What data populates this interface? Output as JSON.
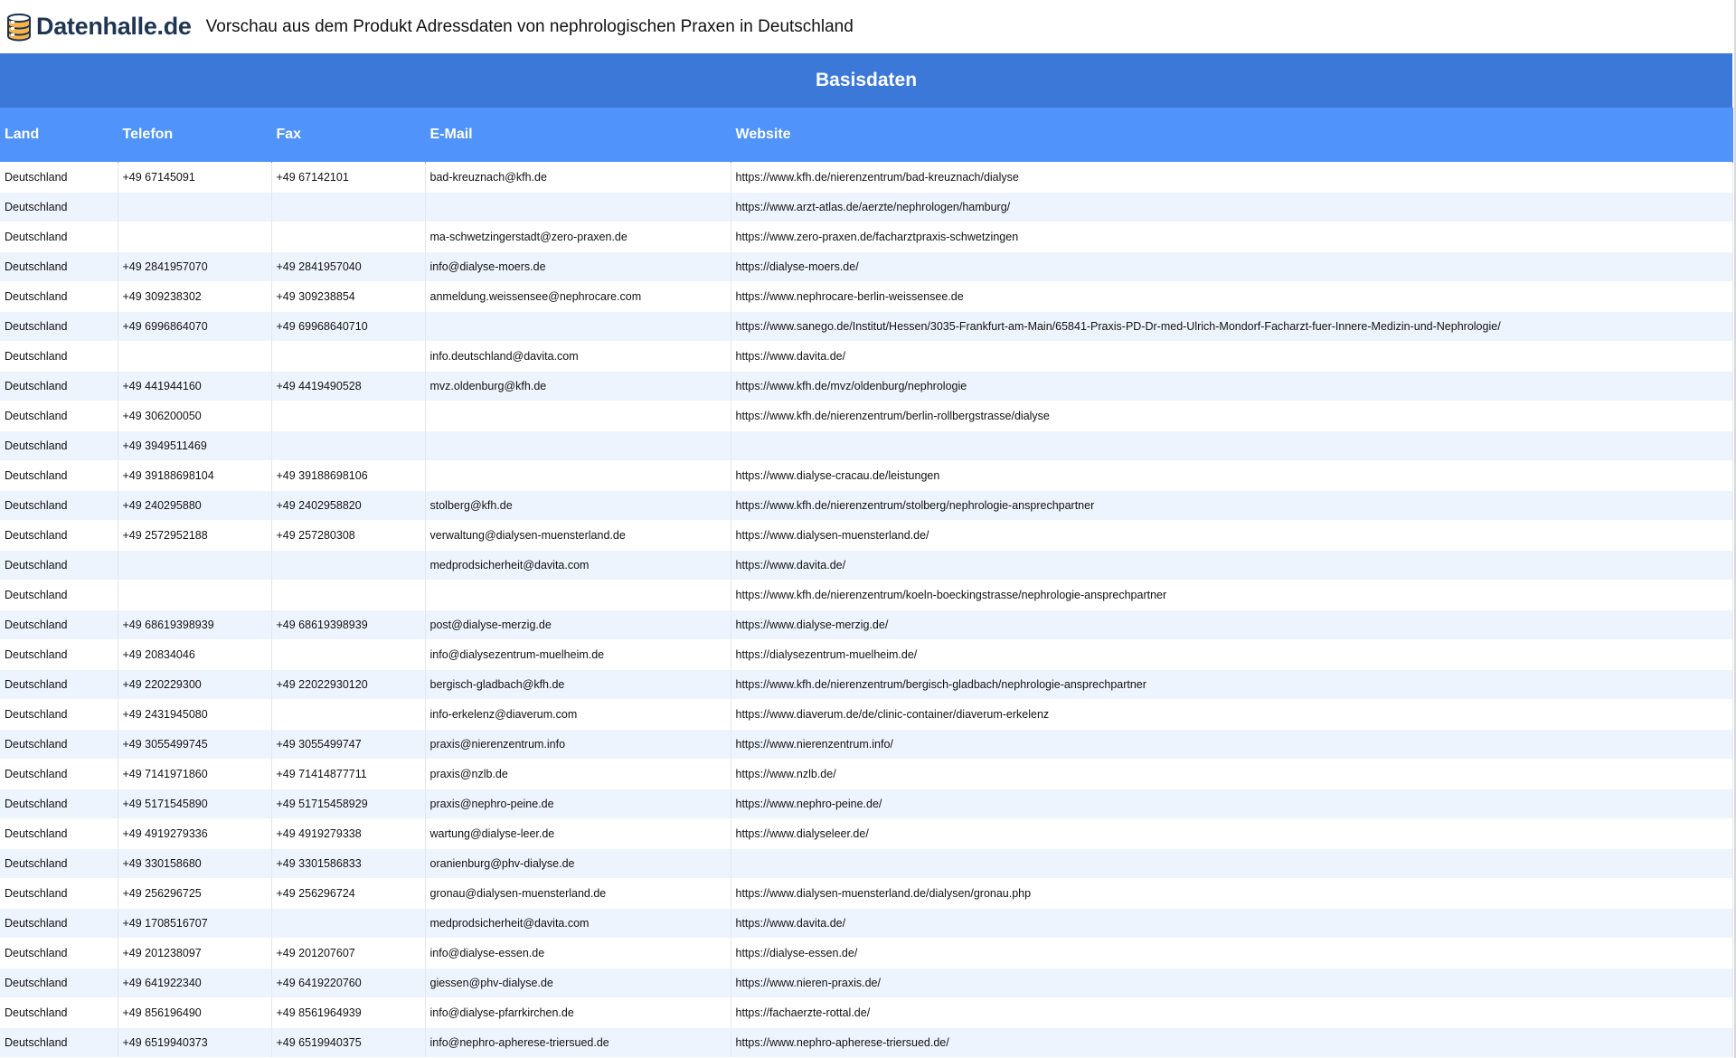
{
  "header": {
    "logo_text": "Datenhalle.de",
    "title": "Vorschau aus dem Produkt Adressdaten von nephrologischen Praxen in Deutschland"
  },
  "table": {
    "group_header": "Basisdaten",
    "columns": [
      "Land",
      "Telefon",
      "Fax",
      "E-Mail",
      "Website"
    ],
    "rows": [
      [
        "Deutschland",
        "+49 67145091",
        "+49 67142101",
        "bad-kreuznach@kfh.de",
        "https://www.kfh.de/nierenzentrum/bad-kreuznach/dialyse"
      ],
      [
        "Deutschland",
        "",
        "",
        "",
        "https://www.arzt-atlas.de/aerzte/nephrologen/hamburg/"
      ],
      [
        "Deutschland",
        "",
        "",
        "ma-schwetzingerstadt@zero-praxen.de",
        "https://www.zero-praxen.de/facharztpraxis-schwetzingen"
      ],
      [
        "Deutschland",
        "+49 2841957070",
        "+49 2841957040",
        "info@dialyse-moers.de",
        "https://dialyse-moers.de/"
      ],
      [
        "Deutschland",
        "+49 309238302",
        "+49 309238854",
        "anmeldung.weissensee@nephrocare.com",
        "https://www.nephrocare-berlin-weissensee.de"
      ],
      [
        "Deutschland",
        "+49 6996864070",
        "+49 69968640710",
        "",
        "https://www.sanego.de/Institut/Hessen/3035-Frankfurt-am-Main/65841-Praxis-PD-Dr-med-Ulrich-Mondorf-Facharzt-fuer-Innere-Medizin-und-Nephrologie/"
      ],
      [
        "Deutschland",
        "",
        "",
        "info.deutschland@davita.com",
        "https://www.davita.de/"
      ],
      [
        "Deutschland",
        "+49 441944160",
        "+49 4419490528",
        "mvz.oldenburg@kfh.de",
        "https://www.kfh.de/mvz/oldenburg/nephrologie"
      ],
      [
        "Deutschland",
        "+49 306200050",
        "",
        "",
        "https://www.kfh.de/nierenzentrum/berlin-rollbergstrasse/dialyse"
      ],
      [
        "Deutschland",
        "+49 3949511469",
        "",
        "",
        ""
      ],
      [
        "Deutschland",
        "+49 39188698104",
        "+49 39188698106",
        "",
        "https://www.dialyse-cracau.de/leistungen"
      ],
      [
        "Deutschland",
        "+49 240295880",
        "+49 2402958820",
        "stolberg@kfh.de",
        "https://www.kfh.de/nierenzentrum/stolberg/nephrologie-ansprechpartner"
      ],
      [
        "Deutschland",
        "+49 2572952188",
        "+49 257280308",
        "verwaltung@dialysen-muensterland.de",
        "https://www.dialysen-muensterland.de/"
      ],
      [
        "Deutschland",
        "",
        "",
        "medprodsicherheit@davita.com",
        "https://www.davita.de/"
      ],
      [
        "Deutschland",
        "",
        "",
        "",
        "https://www.kfh.de/nierenzentrum/koeln-boeckingstrasse/nephrologie-ansprechpartner"
      ],
      [
        "Deutschland",
        "+49 68619398939",
        "+49 68619398939",
        "post@dialyse-merzig.de",
        "https://www.dialyse-merzig.de/"
      ],
      [
        "Deutschland",
        "+49 20834046",
        "",
        "info@dialysezentrum-muelheim.de",
        "https://dialysezentrum-muelheim.de/"
      ],
      [
        "Deutschland",
        "+49 220229300",
        "+49 22022930120",
        "bergisch-gladbach@kfh.de",
        "https://www.kfh.de/nierenzentrum/bergisch-gladbach/nephrologie-ansprechpartner"
      ],
      [
        "Deutschland",
        "+49 2431945080",
        "",
        "info-erkelenz@diaverum.com",
        "https://www.diaverum.de/de/clinic-container/diaverum-erkelenz"
      ],
      [
        "Deutschland",
        "+49 3055499745",
        "+49 3055499747",
        "praxis@nierenzentrum.info",
        "https://www.nierenzentrum.info/"
      ],
      [
        "Deutschland",
        "+49 7141971860",
        "+49 71414877711",
        "praxis@nzlb.de",
        "https://www.nzlb.de/"
      ],
      [
        "Deutschland",
        "+49 5171545890",
        "+49 51715458929",
        "praxis@nephro-peine.de",
        "https://www.nephro-peine.de/"
      ],
      [
        "Deutschland",
        "+49 4919279336",
        "+49 4919279338",
        "wartung@dialyse-leer.de",
        "https://www.dialyseleer.de/"
      ],
      [
        "Deutschland",
        "+49 330158680",
        "+49 3301586833",
        "oranienburg@phv-dialyse.de",
        ""
      ],
      [
        "Deutschland",
        "+49 256296725",
        "+49 256296724",
        "gronau@dialysen-muensterland.de",
        "https://www.dialysen-muensterland.de/dialysen/gronau.php"
      ],
      [
        "Deutschland",
        "+49 1708516707",
        "",
        "medprodsicherheit@davita.com",
        "https://www.davita.de/"
      ],
      [
        "Deutschland",
        "+49 201238097",
        "+49 201207607",
        "info@dialyse-essen.de",
        "https://dialyse-essen.de/"
      ],
      [
        "Deutschland",
        "+49 641922340",
        "+49 6419220760",
        "giessen@phv-dialyse.de",
        "https://www.nieren-praxis.de/"
      ],
      [
        "Deutschland",
        "+49 856196490",
        "+49 8561964939",
        "info@dialyse-pfarrkirchen.de",
        "https://fachaerzte-rottal.de/"
      ],
      [
        "Deutschland",
        "+49 6519940373",
        "+49 6519940375",
        "info@nephro-apherese-triersued.de",
        "https://www.nephro-apherese-triersued.de/"
      ]
    ]
  },
  "colors": {
    "group_header_bg": "#3b78d8",
    "column_header_bg": "#4f93fb",
    "row_alt_bg": "#eef4fd",
    "logo_text": "#1f3552"
  },
  "icons": {
    "logo": "database-stack-icon"
  }
}
